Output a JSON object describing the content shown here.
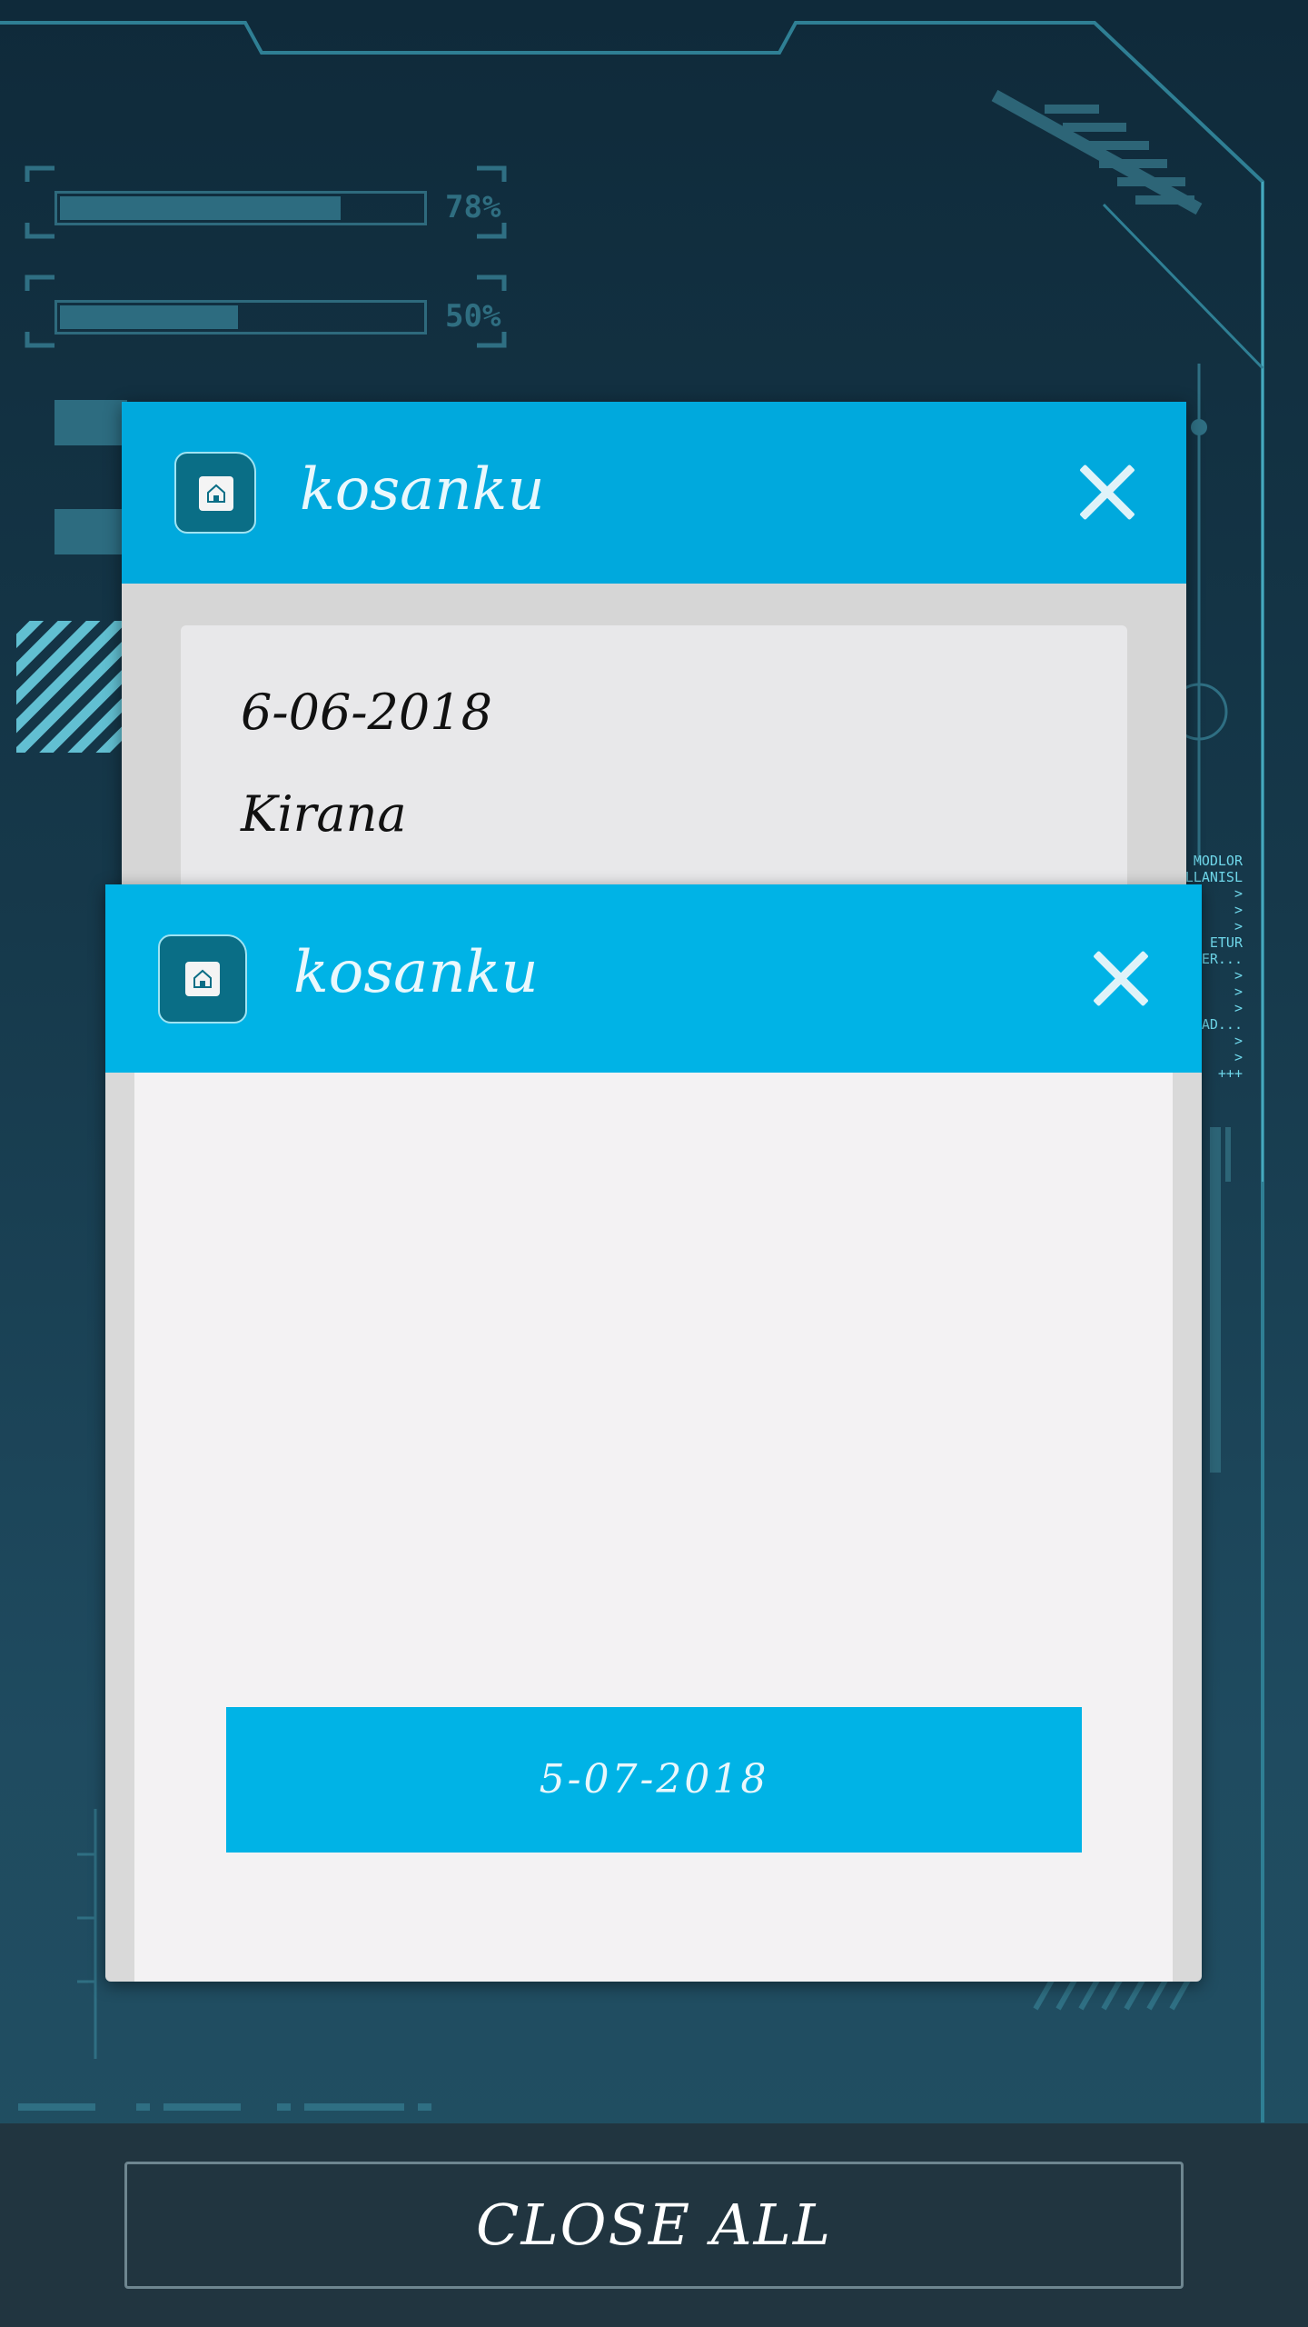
{
  "background": {
    "progress_bars": [
      {
        "label": "78%",
        "value": 0.78
      },
      {
        "label": "50%",
        "value": 0.5
      }
    ],
    "side_readout": [
      "MODLOR",
      "LLANISL",
      ">",
      ">",
      ">",
      "ETUR",
      "VER...",
      ">",
      ">",
      ">",
      "OAD...",
      ">",
      ">",
      "+++"
    ]
  },
  "windows": [
    {
      "title": "kosanku",
      "icon": "home-icon",
      "close_icon": "close-icon",
      "lines": [
        "6-06-2018",
        "Kirana"
      ]
    },
    {
      "title": "kosanku",
      "icon": "home-icon",
      "close_icon": "close-icon",
      "date_button": "5-07-2018"
    }
  ],
  "footer": {
    "close_all_label": "CLOSE ALL"
  },
  "colors": {
    "header": "#00b3e6",
    "background": "#16394b",
    "footer": "#213540"
  }
}
